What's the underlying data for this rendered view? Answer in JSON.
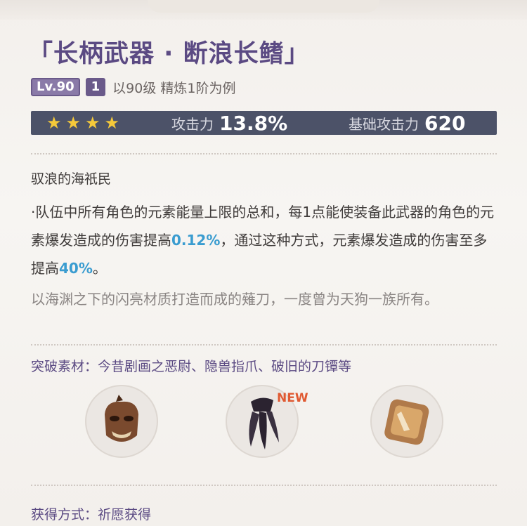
{
  "weapon": {
    "title": "「长柄武器 · 断浪长鳍」",
    "level_badge": "Lv.90",
    "refine_badge": "1",
    "level_note": "以90级 精炼1阶为例"
  },
  "stats": {
    "stars": 4,
    "sub_label": "攻击力",
    "sub_value": "13.8%",
    "base_label": "基础攻击力",
    "base_value": "620"
  },
  "passive": {
    "name": "驭浪的海祇民",
    "desc_part1": "·队伍中所有角色的元素能量上限的总和，每1点能使装备此武器的角色的元素爆发造成的伤害提高",
    "highlight1": "0.12%",
    "desc_part2": "，通过这种方式，元素爆发造成的伤害至多提高",
    "highlight2": "40%",
    "desc_part3": "。"
  },
  "flavor": "以海渊之下的闪亮材质打造而成的薙刀，一度曾为天狗一族所有。",
  "materials": {
    "label": "突破素材：今昔剧画之恶尉、隐兽指爪、破旧的刀镡等",
    "new_tag": "NEW"
  },
  "obtain": "获得方式：祈愿获得",
  "colors": {
    "accent": "#5b4a83",
    "highlight": "#3a9cd0",
    "stat_bar": "#4c5268",
    "star": "#f5c93a",
    "new": "#e05a32"
  }
}
